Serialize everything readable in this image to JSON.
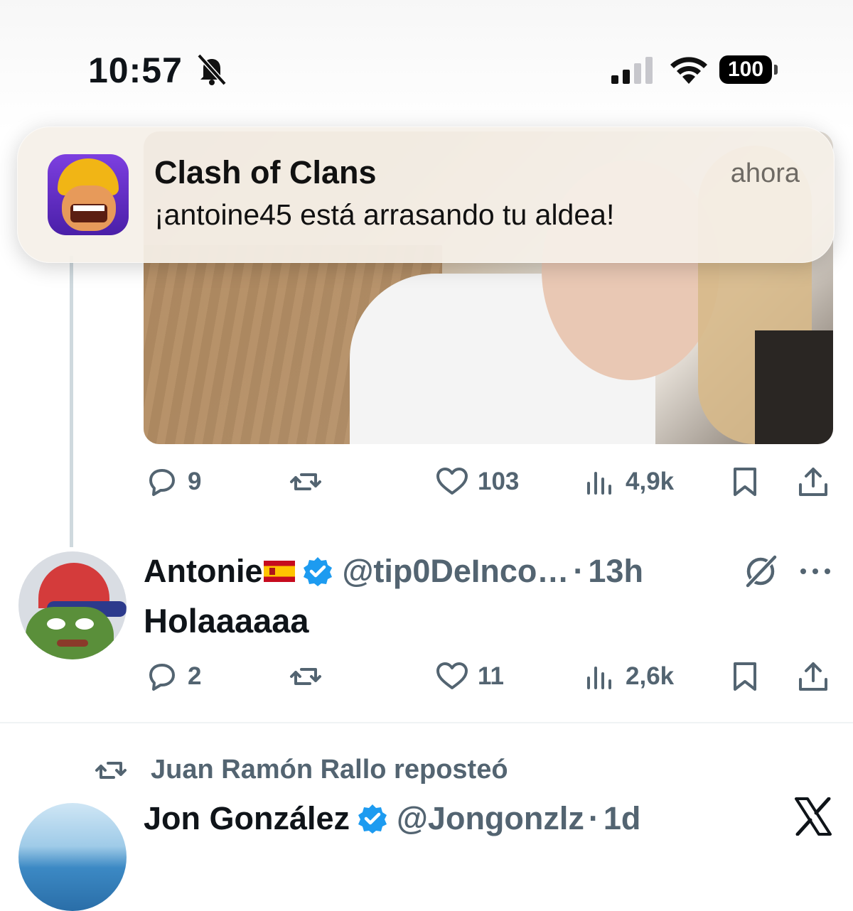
{
  "status_bar": {
    "time": "10:57",
    "battery": "100"
  },
  "notification": {
    "app_name": "Clash of Clans",
    "time": "ahora",
    "message": "¡antoine45 está arrasando tu aldea!"
  },
  "first_tweet_actions": {
    "replies": "9",
    "reposts": "",
    "likes": "103",
    "views": "4,9k"
  },
  "reply_tweet": {
    "name": "Antonie",
    "name_emoji": "flag-spain-icon",
    "handle": "@tip0DeInco…",
    "separator": "·",
    "time": "13h",
    "text": "Holaaaaaa",
    "actions": {
      "replies": "2",
      "reposts": "",
      "likes": "11",
      "views": "2,6k"
    }
  },
  "repost_banner": {
    "text": "Juan Ramón Rallo reposteó"
  },
  "next_tweet": {
    "name": "Jon González",
    "handle": "@Jongonzlz",
    "separator": "·",
    "time": "1d"
  },
  "colors": {
    "verified": "#1d9bf0",
    "muted_text": "#536471",
    "primary_text": "#0f1419"
  }
}
